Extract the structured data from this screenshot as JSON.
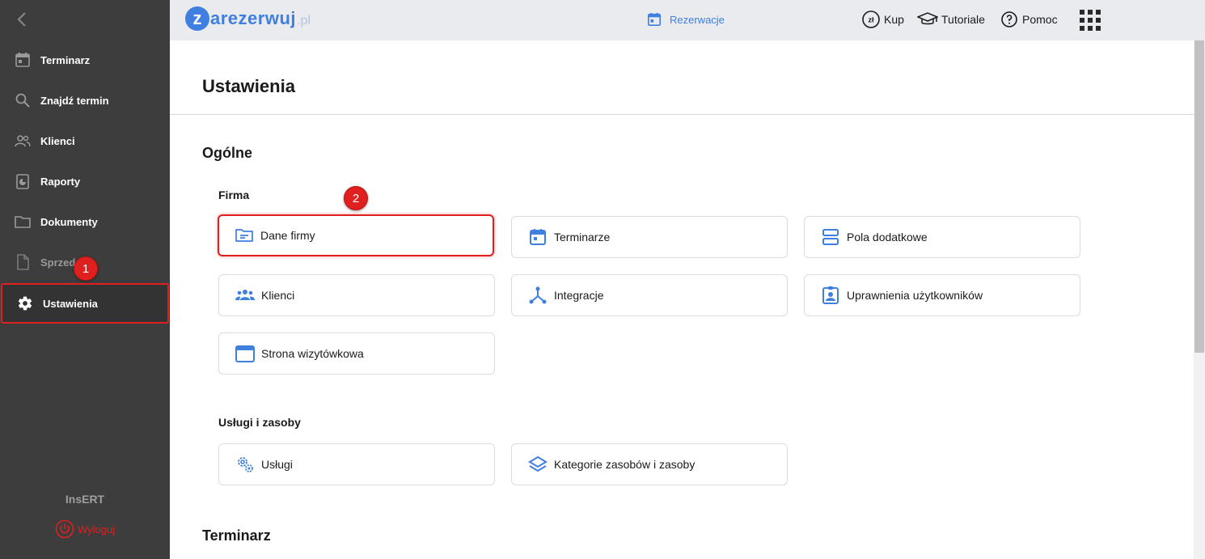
{
  "sidebar": {
    "items": [
      {
        "label": "Terminarz",
        "icon": "calendar-icon"
      },
      {
        "label": "Znajdź termin",
        "icon": "search-icon"
      },
      {
        "label": "Klienci",
        "icon": "people-icon"
      },
      {
        "label": "Raporty",
        "icon": "report-icon"
      },
      {
        "label": "Dokumenty",
        "icon": "folder-icon"
      },
      {
        "label": "Sprzedaż",
        "icon": "document-icon"
      },
      {
        "label": "Ustawienia",
        "icon": "gear-icon"
      }
    ],
    "brand": "InsERT",
    "logout": "Wyloguj"
  },
  "topbar": {
    "logo_letter": "z",
    "logo_word": "arezerwuj",
    "logo_tld": ".pl",
    "reservations": "Rezerwacje",
    "buy": "Kup",
    "tutorials": "Tutoriale",
    "help": "Pomoc",
    "currency_symbol": "zł"
  },
  "page": {
    "title": "Ustawienia",
    "sections": {
      "general": "Ogólne",
      "schedule": "Terminarz"
    },
    "groups": {
      "company": "Firma",
      "services": "Usługi i zasoby"
    },
    "cards": {
      "company_data": "Dane firmy",
      "schedules": "Terminarze",
      "extra_fields": "Pola dodatkowe",
      "clients": "Klienci",
      "integrations": "Integracje",
      "user_permissions": "Uprawnienia użytkowników",
      "business_page": "Strona wizytówkowa",
      "services": "Usługi",
      "resource_categories": "Kategorie zasobów i zasoby"
    }
  },
  "annotations": {
    "step1": "1",
    "step2": "2"
  },
  "colors": {
    "accent": "#3f7fe0",
    "sidebar_bg": "#3d3d3d",
    "highlight": "#e0201f",
    "topbar_bg": "#e9ebef"
  }
}
